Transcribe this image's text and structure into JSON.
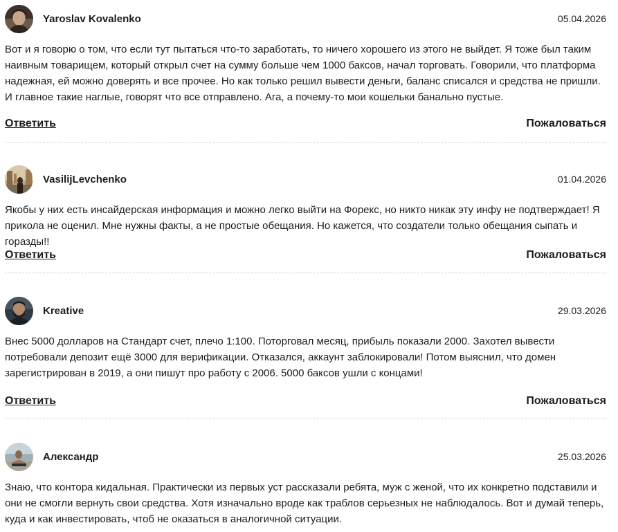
{
  "comments": [
    {
      "author": "Yaroslav Kovalenko",
      "date": "05.04.2026",
      "avatar_icon": "user-photo-man-portrait",
      "text": "Вот и я говорю о том, что если тут пытаться что-то заработать, то ничего хорошего из этого не выйдет. Я тоже был таким наивным товарищем, который открыл счет на сумму больше чем 1000 баксов, начал торговать. Говорили, что платформа надежная, ей можно доверять и все прочее. Но как только решил вывести деньги, баланс списался и средства не пришли. И главное такие наглые, говорят что все отправлено. Ага, а почему-то мои кошельки банально пустые.",
      "reply_label": "Ответить",
      "report_label": "Пожаловаться"
    },
    {
      "author": "VasilijLevchenko",
      "date": "01.04.2026",
      "avatar_icon": "user-photo-city-street",
      "text": "Якобы у них есть инсайдерская информация и можно легко выйти на Форекс, но никто никак эту инфу не подтверждает! Я прикола не оценил. Мне нужны факты, а не простые обещания. Но кажется, что создатели только обещания сыпать и горазды!!",
      "reply_label": "Ответить",
      "report_label": "Пожаловаться"
    },
    {
      "author": "Kreative",
      "date": "29.03.2026",
      "avatar_icon": "user-photo-bearded-man",
      "text": "Внес 5000 долларов на Стандарт счет, плечо 1:100. Поторговал месяц, прибыль показали 2000. Захотел вывести потребовали депозит ещё 3000 для верификации. Отказался, аккаунт заблокировали! Потом выяснил, что домен зарегистрирован в 2019, а они пишут про работу с 2006. 5000 баксов ушли с концами!",
      "reply_label": "Ответить",
      "report_label": "Пожаловаться"
    },
    {
      "author": "Александр",
      "date": "25.03.2026",
      "avatar_icon": "user-photo-man-beach",
      "text": "Знаю, что контора кидальная. Практически из первых уст рассказали ребята, муж с женой, что их конкретно подставили и они не смогли вернуть свои средства. Хотя изначально вроде как траблов серьезных не наблюдалось. Вот и думай теперь, куда и как инвестировать, чтоб не оказаться в аналогичной ситуации."
    }
  ]
}
